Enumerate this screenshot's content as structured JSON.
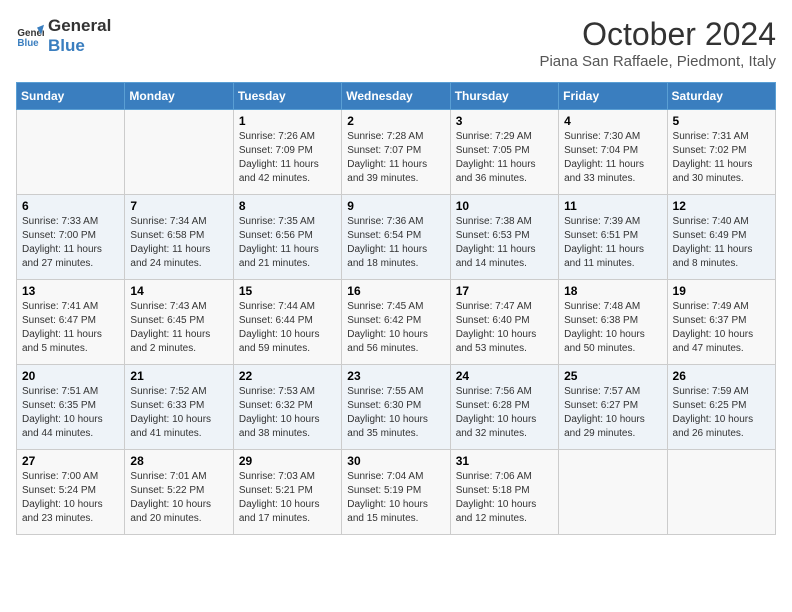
{
  "header": {
    "logo_line1": "General",
    "logo_line2": "Blue",
    "month_title": "October 2024",
    "location": "Piana San Raffaele, Piedmont, Italy"
  },
  "days_of_week": [
    "Sunday",
    "Monday",
    "Tuesday",
    "Wednesday",
    "Thursday",
    "Friday",
    "Saturday"
  ],
  "weeks": [
    [
      {
        "day": "",
        "info": ""
      },
      {
        "day": "",
        "info": ""
      },
      {
        "day": "1",
        "info": "Sunrise: 7:26 AM\nSunset: 7:09 PM\nDaylight: 11 hours and 42 minutes."
      },
      {
        "day": "2",
        "info": "Sunrise: 7:28 AM\nSunset: 7:07 PM\nDaylight: 11 hours and 39 minutes."
      },
      {
        "day": "3",
        "info": "Sunrise: 7:29 AM\nSunset: 7:05 PM\nDaylight: 11 hours and 36 minutes."
      },
      {
        "day": "4",
        "info": "Sunrise: 7:30 AM\nSunset: 7:04 PM\nDaylight: 11 hours and 33 minutes."
      },
      {
        "day": "5",
        "info": "Sunrise: 7:31 AM\nSunset: 7:02 PM\nDaylight: 11 hours and 30 minutes."
      }
    ],
    [
      {
        "day": "6",
        "info": "Sunrise: 7:33 AM\nSunset: 7:00 PM\nDaylight: 11 hours and 27 minutes."
      },
      {
        "day": "7",
        "info": "Sunrise: 7:34 AM\nSunset: 6:58 PM\nDaylight: 11 hours and 24 minutes."
      },
      {
        "day": "8",
        "info": "Sunrise: 7:35 AM\nSunset: 6:56 PM\nDaylight: 11 hours and 21 minutes."
      },
      {
        "day": "9",
        "info": "Sunrise: 7:36 AM\nSunset: 6:54 PM\nDaylight: 11 hours and 18 minutes."
      },
      {
        "day": "10",
        "info": "Sunrise: 7:38 AM\nSunset: 6:53 PM\nDaylight: 11 hours and 14 minutes."
      },
      {
        "day": "11",
        "info": "Sunrise: 7:39 AM\nSunset: 6:51 PM\nDaylight: 11 hours and 11 minutes."
      },
      {
        "day": "12",
        "info": "Sunrise: 7:40 AM\nSunset: 6:49 PM\nDaylight: 11 hours and 8 minutes."
      }
    ],
    [
      {
        "day": "13",
        "info": "Sunrise: 7:41 AM\nSunset: 6:47 PM\nDaylight: 11 hours and 5 minutes."
      },
      {
        "day": "14",
        "info": "Sunrise: 7:43 AM\nSunset: 6:45 PM\nDaylight: 11 hours and 2 minutes."
      },
      {
        "day": "15",
        "info": "Sunrise: 7:44 AM\nSunset: 6:44 PM\nDaylight: 10 hours and 59 minutes."
      },
      {
        "day": "16",
        "info": "Sunrise: 7:45 AM\nSunset: 6:42 PM\nDaylight: 10 hours and 56 minutes."
      },
      {
        "day": "17",
        "info": "Sunrise: 7:47 AM\nSunset: 6:40 PM\nDaylight: 10 hours and 53 minutes."
      },
      {
        "day": "18",
        "info": "Sunrise: 7:48 AM\nSunset: 6:38 PM\nDaylight: 10 hours and 50 minutes."
      },
      {
        "day": "19",
        "info": "Sunrise: 7:49 AM\nSunset: 6:37 PM\nDaylight: 10 hours and 47 minutes."
      }
    ],
    [
      {
        "day": "20",
        "info": "Sunrise: 7:51 AM\nSunset: 6:35 PM\nDaylight: 10 hours and 44 minutes."
      },
      {
        "day": "21",
        "info": "Sunrise: 7:52 AM\nSunset: 6:33 PM\nDaylight: 10 hours and 41 minutes."
      },
      {
        "day": "22",
        "info": "Sunrise: 7:53 AM\nSunset: 6:32 PM\nDaylight: 10 hours and 38 minutes."
      },
      {
        "day": "23",
        "info": "Sunrise: 7:55 AM\nSunset: 6:30 PM\nDaylight: 10 hours and 35 minutes."
      },
      {
        "day": "24",
        "info": "Sunrise: 7:56 AM\nSunset: 6:28 PM\nDaylight: 10 hours and 32 minutes."
      },
      {
        "day": "25",
        "info": "Sunrise: 7:57 AM\nSunset: 6:27 PM\nDaylight: 10 hours and 29 minutes."
      },
      {
        "day": "26",
        "info": "Sunrise: 7:59 AM\nSunset: 6:25 PM\nDaylight: 10 hours and 26 minutes."
      }
    ],
    [
      {
        "day": "27",
        "info": "Sunrise: 7:00 AM\nSunset: 5:24 PM\nDaylight: 10 hours and 23 minutes."
      },
      {
        "day": "28",
        "info": "Sunrise: 7:01 AM\nSunset: 5:22 PM\nDaylight: 10 hours and 20 minutes."
      },
      {
        "day": "29",
        "info": "Sunrise: 7:03 AM\nSunset: 5:21 PM\nDaylight: 10 hours and 17 minutes."
      },
      {
        "day": "30",
        "info": "Sunrise: 7:04 AM\nSunset: 5:19 PM\nDaylight: 10 hours and 15 minutes."
      },
      {
        "day": "31",
        "info": "Sunrise: 7:06 AM\nSunset: 5:18 PM\nDaylight: 10 hours and 12 minutes."
      },
      {
        "day": "",
        "info": ""
      },
      {
        "day": "",
        "info": ""
      }
    ]
  ]
}
